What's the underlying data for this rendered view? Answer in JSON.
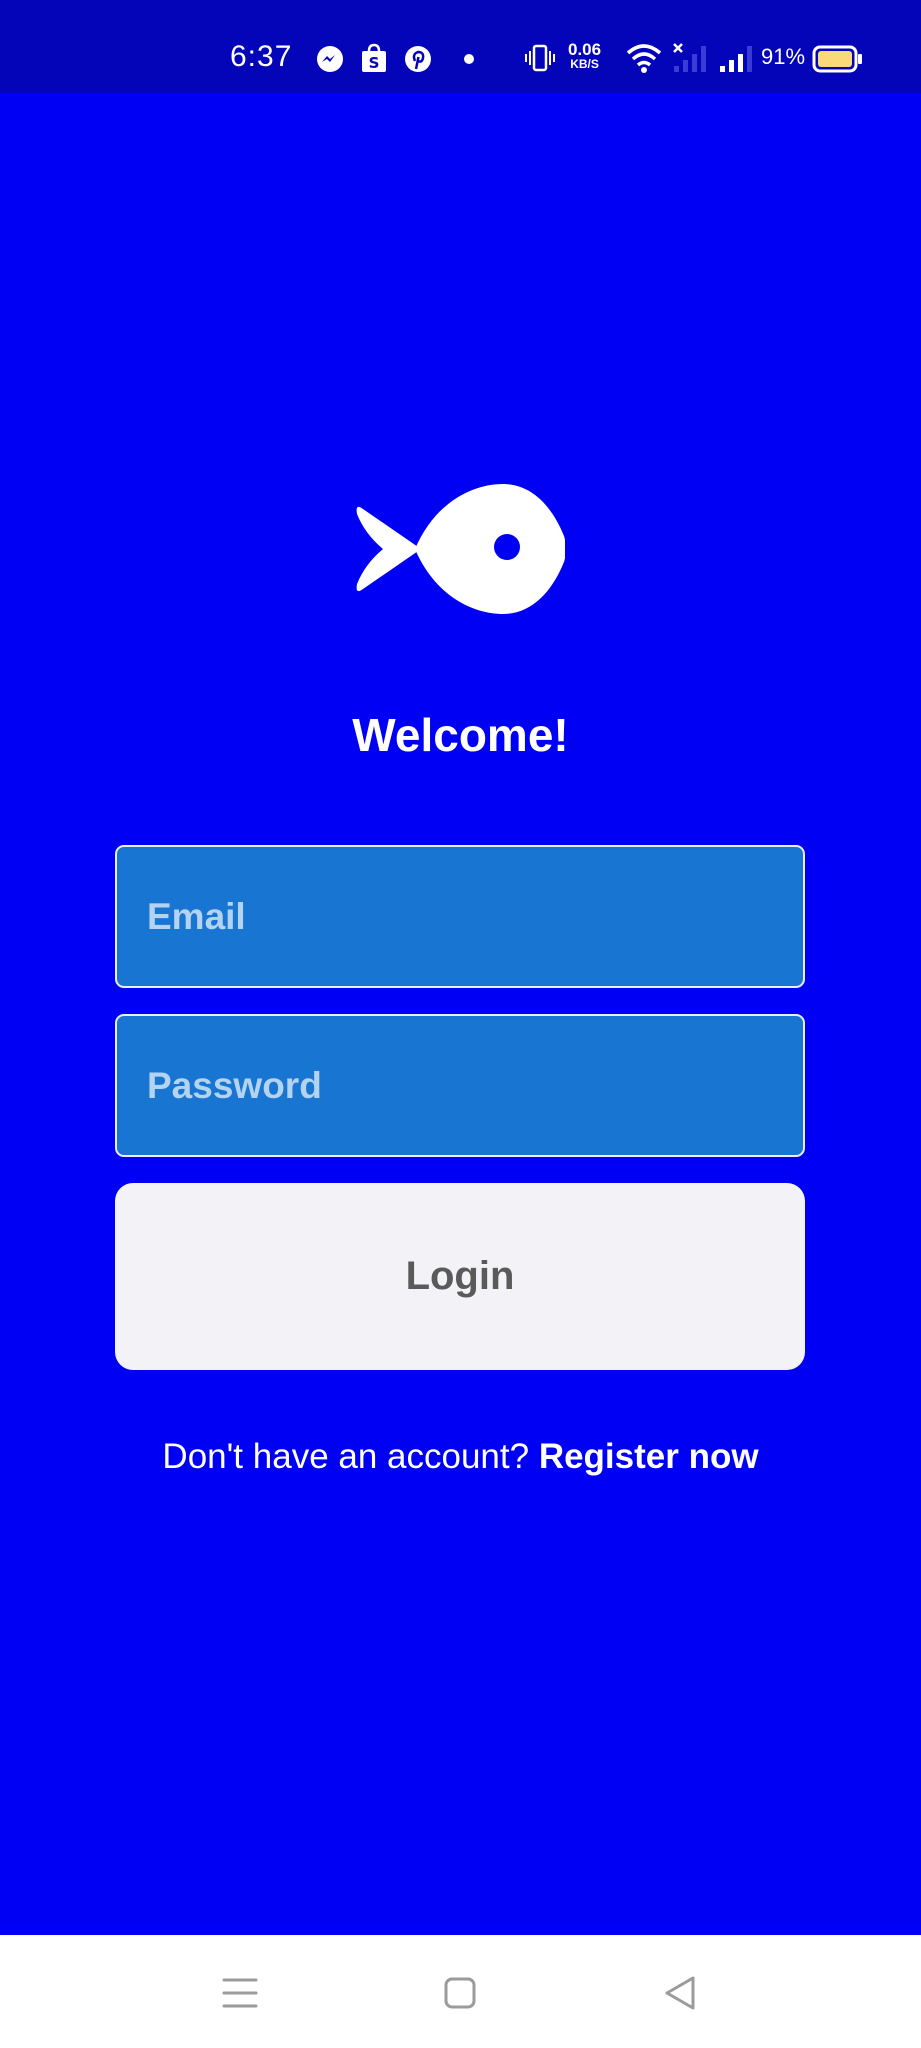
{
  "status_bar": {
    "time": "6:37",
    "net_speed": "0.06",
    "net_unit": "KB/S",
    "battery_percent": "91%",
    "icons": [
      "messenger-icon",
      "shopping-bag-icon",
      "pinterest-icon",
      "dot-icon",
      "vibrate-icon",
      "wifi-icon",
      "signal-no-service-icon",
      "signal-icon",
      "battery-icon"
    ]
  },
  "app": {
    "logo_icon": "fish-icon",
    "welcome": "Welcome!"
  },
  "form": {
    "email_placeholder": "Email",
    "password_placeholder": "Password",
    "login_label": "Login"
  },
  "register": {
    "prompt": "Don't have an account? ",
    "link": "Register now"
  },
  "nav_bar": {
    "icons": [
      "menu-icon",
      "home-icon",
      "back-icon"
    ]
  },
  "colors": {
    "background": "#0000f5",
    "status_bar": "#0404b8",
    "field_fill": "#1876d2",
    "button_fill": "#f3f2f6",
    "button_text": "#5a5a5a"
  }
}
